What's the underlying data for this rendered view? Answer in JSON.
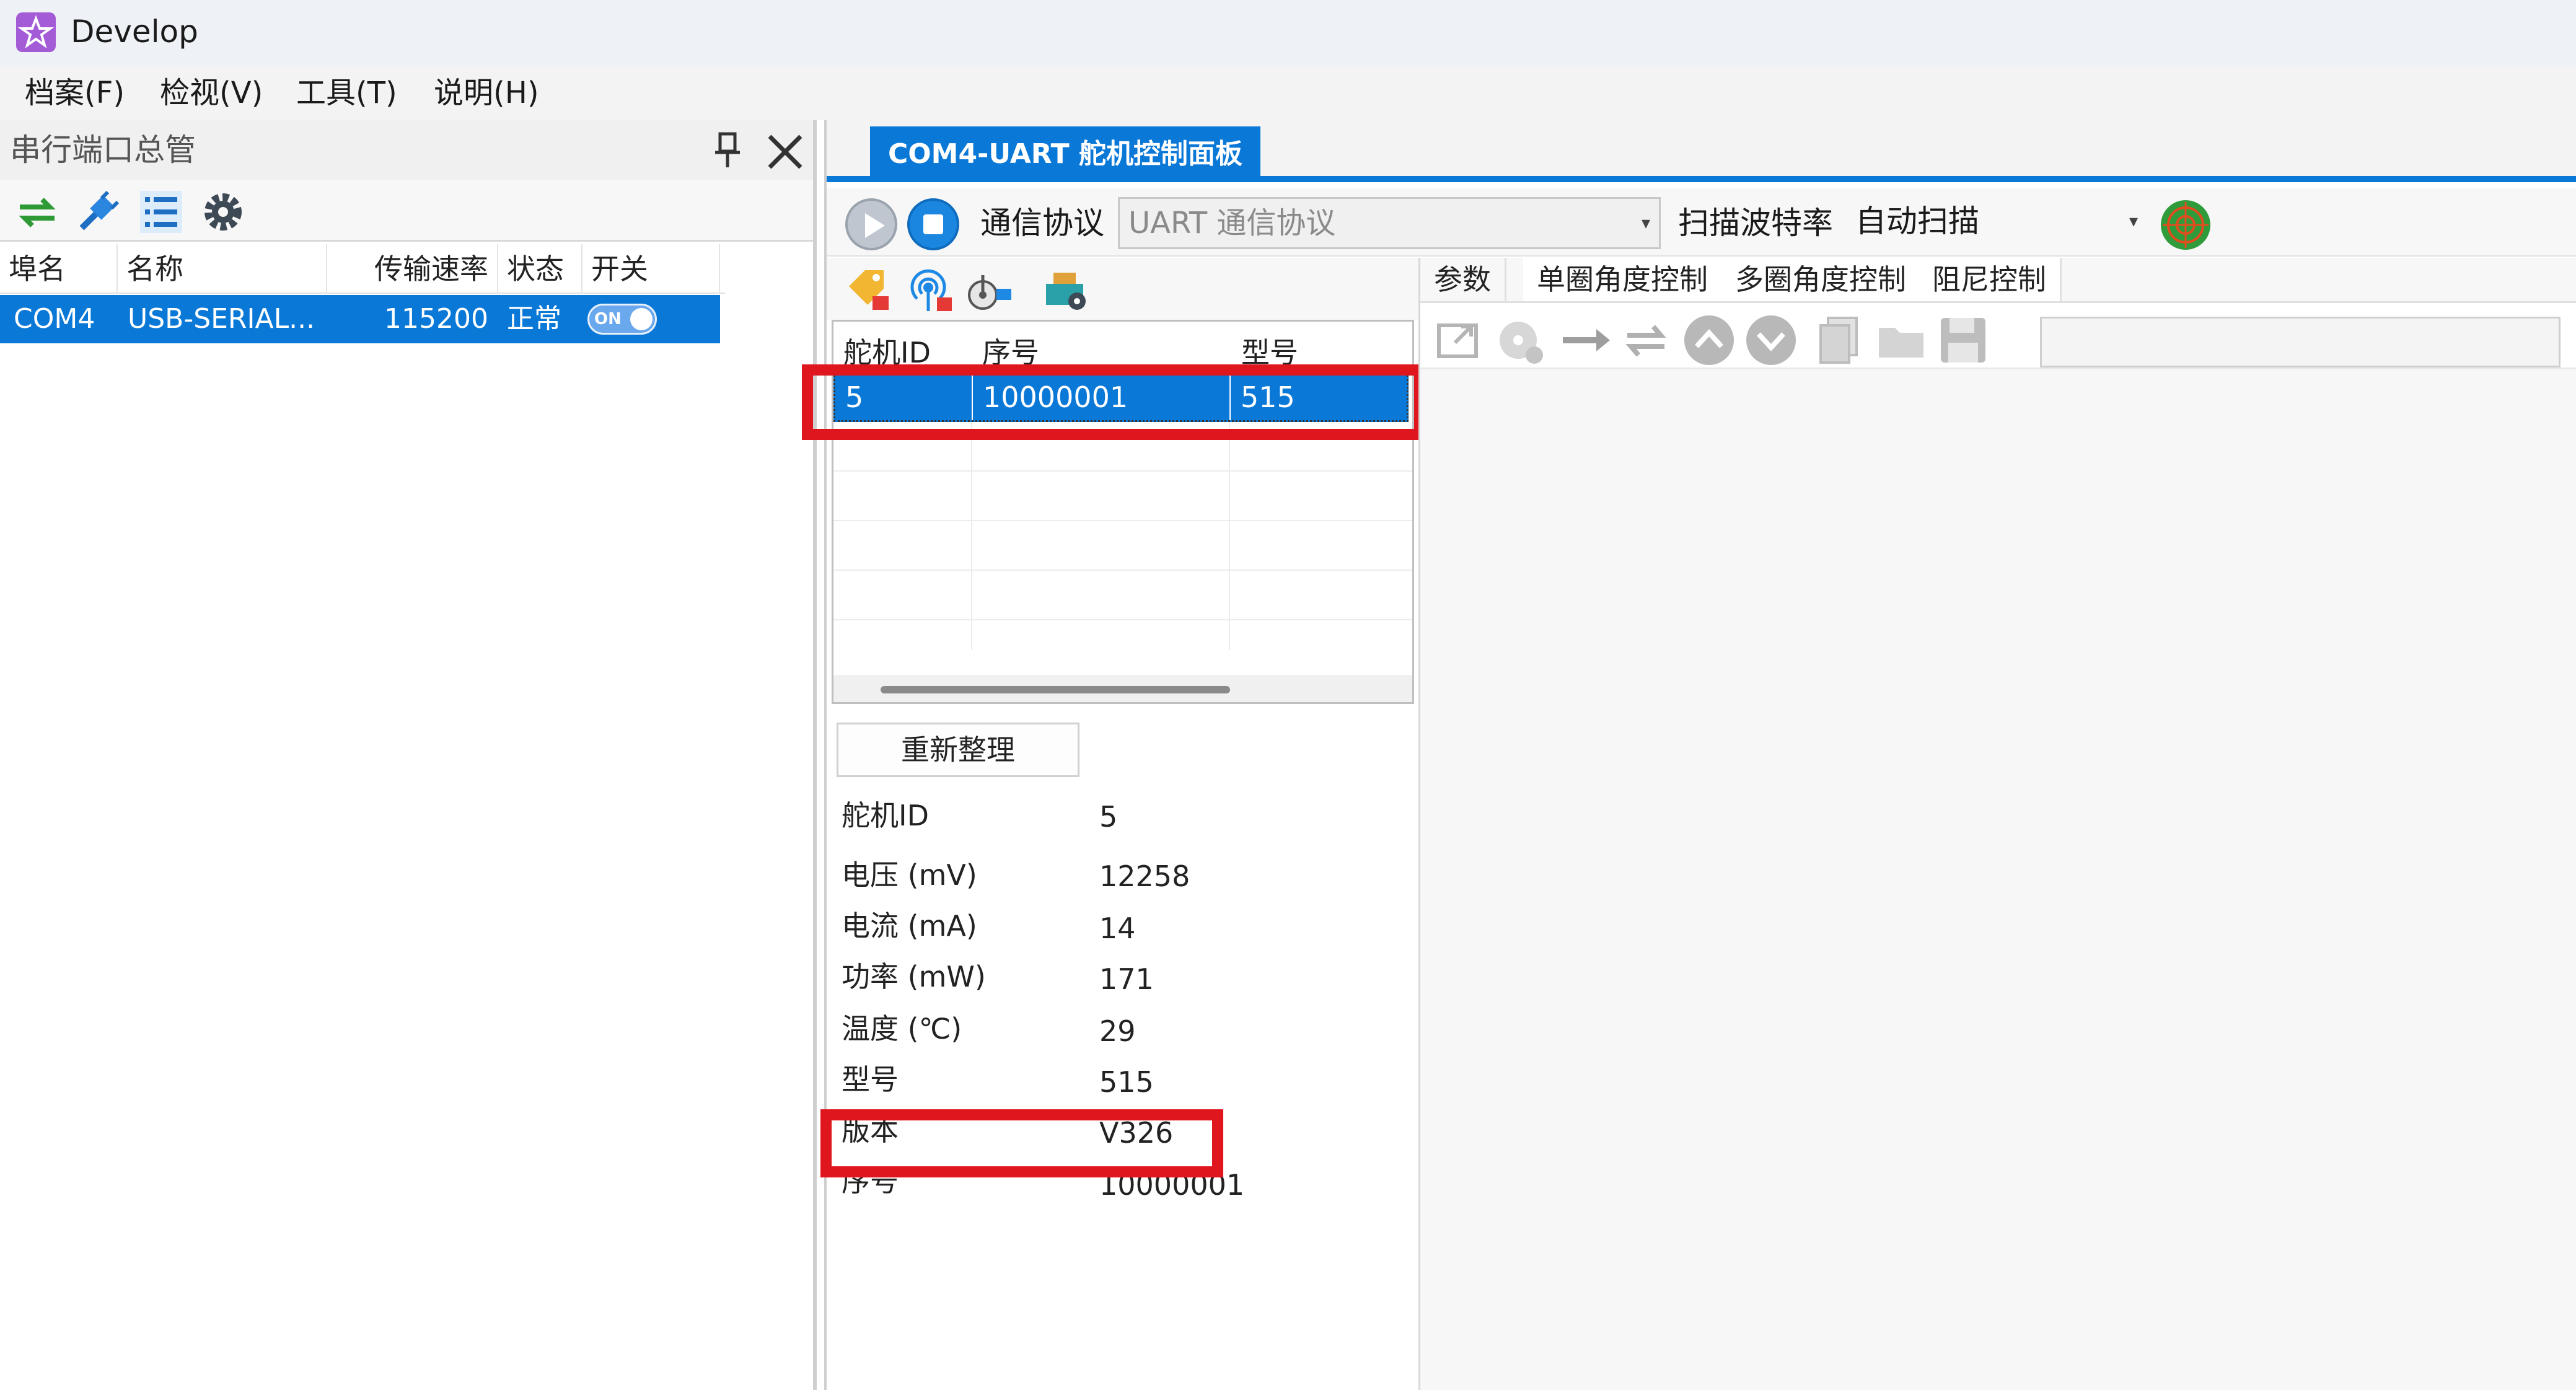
{
  "window": {
    "title": "Develop"
  },
  "menu": [
    {
      "label": "档案(F)"
    },
    {
      "label": "检视(V)"
    },
    {
      "label": "工具(T)"
    },
    {
      "label": "说明(H)"
    }
  ],
  "port_panel": {
    "title": "串行端口总管",
    "columns": [
      "埠名",
      "名称",
      "传输速率",
      "状态",
      "开关"
    ],
    "rows": [
      {
        "port": "COM4",
        "name": "USB-SERIAL...",
        "baud": "115200",
        "status": "正常",
        "switch": "ON"
      }
    ]
  },
  "doc_tab": {
    "label": "COM4-UART 舵机控制面板"
  },
  "protocol_bar": {
    "protocol_label": "通信协议",
    "protocol_value": "UART 通信协议",
    "baud_label": "扫描波特率",
    "baud_value": "自动扫描"
  },
  "servo_grid": {
    "columns": [
      "舵机ID",
      "序号",
      "型号"
    ],
    "rows": [
      {
        "id": "5",
        "serial": "10000001",
        "model": "515"
      }
    ]
  },
  "reorganize_button": {
    "label": "重新整理"
  },
  "servo_info": [
    {
      "label": "舵机ID",
      "value": "5"
    },
    {
      "label": "电压 (mV)",
      "value": "12258"
    },
    {
      "label": "电流 (mA)",
      "value": "14"
    },
    {
      "label": "功率 (mW)",
      "value": "171"
    },
    {
      "label": "温度 (℃)",
      "value": "29"
    },
    {
      "label": "型号",
      "value": "515"
    },
    {
      "label": "版本",
      "value": "V326"
    },
    {
      "label": "序号",
      "value": "10000001"
    }
  ],
  "sub_tabs": [
    {
      "label": "参数"
    },
    {
      "label": "单圈角度控制"
    },
    {
      "label": "多圈角度控制"
    },
    {
      "label": "阻尼控制"
    }
  ],
  "colors": {
    "accent": "#0a78d7",
    "highlight_box": "#e0161e"
  },
  "icons": {
    "toolbar_left": [
      "refresh-icon",
      "connect-icon",
      "list-icon",
      "gear-icon"
    ],
    "servo_tools": [
      "tag-icon",
      "signal-icon",
      "servo-icon",
      "device-icon"
    ],
    "sub_toolbar": [
      "export-icon",
      "disc-icon",
      "arrow-right-icon",
      "loop-icon",
      "up-icon",
      "down-icon",
      "copy-icon",
      "folder-icon",
      "save-icon"
    ]
  }
}
